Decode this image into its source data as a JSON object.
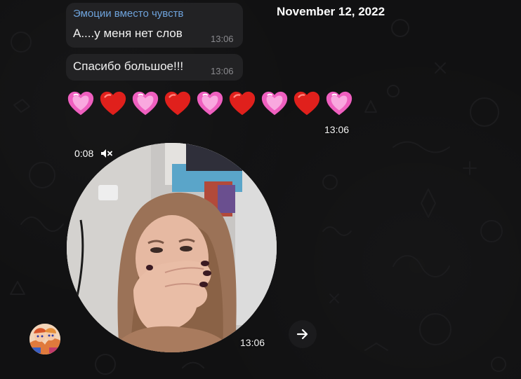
{
  "date_separator": "November 12, 2022",
  "messages": [
    {
      "sender": "Эмоции вместо чувств",
      "text": "А....у меня нет слов",
      "time": "13:06"
    },
    {
      "text": "Спасибо большое!!!",
      "time": "13:06"
    }
  ],
  "emoji_message": {
    "emojis": [
      "sparkling-heart",
      "red-heart",
      "sparkling-heart",
      "red-heart",
      "sparkling-heart",
      "red-heart",
      "sparkling-heart",
      "red-heart",
      "sparkling-heart"
    ],
    "time": "13:06"
  },
  "video_message": {
    "duration": "0:08",
    "muted_icon": "speaker-muted-icon",
    "time": "13:06"
  },
  "forward_icon": "arrow-right-icon",
  "colors": {
    "background": "#111112",
    "bubble": "#222224",
    "sender_name": "#6ea3dc",
    "time_text": "#8a8a8e",
    "pink_heart": "#f472c7",
    "red_heart": "#e0201c"
  }
}
